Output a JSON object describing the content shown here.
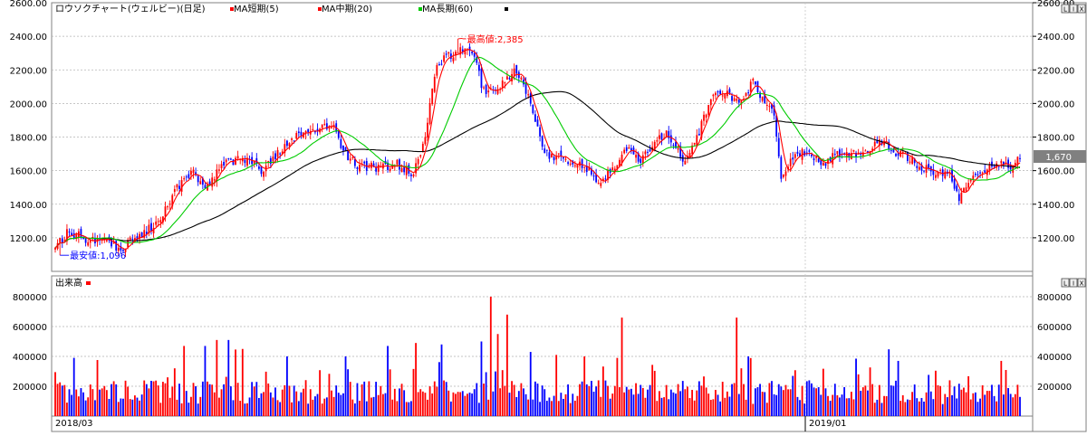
{
  "price_panel": {
    "legend": {
      "title": "ロウソクチャート(ウェルビー)(日足)",
      "ma_short": "MA短期(5)",
      "ma_mid": "MA中期(20)",
      "ma_long": "MA長期(60)"
    },
    "y_ticks": [
      "1200.00",
      "1400.00",
      "1600.00",
      "1800.00",
      "2000.00",
      "2200.00",
      "2400.00",
      "2600.00"
    ],
    "high_label": "最高値:2,385",
    "low_label": "最安値:1,096",
    "last_price": "1,670",
    "colors": {
      "up": "#ff0000",
      "down": "#0000ff",
      "ma_short": "#ff0000",
      "ma_mid": "#00cc00",
      "ma_long": "#000000"
    }
  },
  "volume_panel": {
    "legend": {
      "title": "出来高"
    },
    "y_ticks": [
      "200000",
      "400000",
      "600000",
      "800000"
    ]
  },
  "x_axis": {
    "labels": [
      "2018/03",
      "2019/01"
    ]
  },
  "controls": [
    "L",
    "I",
    "X"
  ],
  "chart_data": [
    {
      "type": "candlestick",
      "title": "ロウソクチャート(ウェルビー)(日足)",
      "series_names": [
        "MA短期(5)",
        "MA中期(20)",
        "MA長期(60)"
      ],
      "ylim": [
        1000,
        2600
      ],
      "x_labels": [
        "2018/03",
        "2019/01"
      ],
      "annotations": [
        {
          "text": "最高値:2,385",
          "value": 2385
        },
        {
          "text": "最安値:1,096",
          "value": 1096
        },
        {
          "text": "1,670",
          "value": 1670
        }
      ],
      "close_trend_knots": [
        [
          0,
          1150
        ],
        [
          6,
          1240
        ],
        [
          12,
          1200
        ],
        [
          22,
          1170
        ],
        [
          28,
          1130
        ],
        [
          35,
          1210
        ],
        [
          44,
          1290
        ],
        [
          52,
          1500
        ],
        [
          58,
          1600
        ],
        [
          64,
          1480
        ],
        [
          72,
          1640
        ],
        [
          80,
          1680
        ],
        [
          88,
          1600
        ],
        [
          96,
          1720
        ],
        [
          104,
          1810
        ],
        [
          112,
          1860
        ],
        [
          118,
          1880
        ],
        [
          124,
          1700
        ],
        [
          130,
          1620
        ],
        [
          138,
          1620
        ],
        [
          146,
          1640
        ],
        [
          153,
          1580
        ],
        [
          158,
          1800
        ],
        [
          163,
          2240
        ],
        [
          167,
          2280
        ],
        [
          172,
          2310
        ],
        [
          178,
          2320
        ],
        [
          183,
          2070
        ],
        [
          188,
          2080
        ],
        [
          192,
          2140
        ],
        [
          197,
          2200
        ],
        [
          203,
          2000
        ],
        [
          209,
          1700
        ],
        [
          216,
          1680
        ],
        [
          222,
          1650
        ],
        [
          228,
          1600
        ],
        [
          232,
          1500
        ],
        [
          238,
          1620
        ],
        [
          244,
          1730
        ],
        [
          250,
          1640
        ],
        [
          256,
          1790
        ],
        [
          262,
          1820
        ],
        [
          268,
          1660
        ],
        [
          274,
          1800
        ],
        [
          280,
          2030
        ],
        [
          286,
          2080
        ],
        [
          292,
          2000
        ],
        [
          298,
          2130
        ],
        [
          303,
          2010
        ],
        [
          307,
          1950
        ],
        [
          310,
          1560
        ],
        [
          316,
          1720
        ],
        [
          322,
          1690
        ],
        [
          328,
          1640
        ],
        [
          334,
          1700
        ],
        [
          340,
          1700
        ],
        [
          346,
          1720
        ],
        [
          352,
          1790
        ],
        [
          358,
          1720
        ],
        [
          364,
          1680
        ],
        [
          370,
          1620
        ],
        [
          376,
          1580
        ],
        [
          382,
          1570
        ],
        [
          386,
          1420
        ],
        [
          390,
          1540
        ],
        [
          396,
          1600
        ],
        [
          402,
          1650
        ],
        [
          408,
          1620
        ],
        [
          412,
          1670
        ]
      ]
    },
    {
      "type": "bar",
      "title": "出来高",
      "ylim": [
        0,
        800000
      ],
      "peak_volumes": [
        {
          "bar_index": 186,
          "value": 800000
        },
        {
          "bar_index": 193,
          "value": 680000
        },
        {
          "bar_index": 242,
          "value": 660000
        },
        {
          "bar_index": 291,
          "value": 660000
        }
      ]
    }
  ]
}
